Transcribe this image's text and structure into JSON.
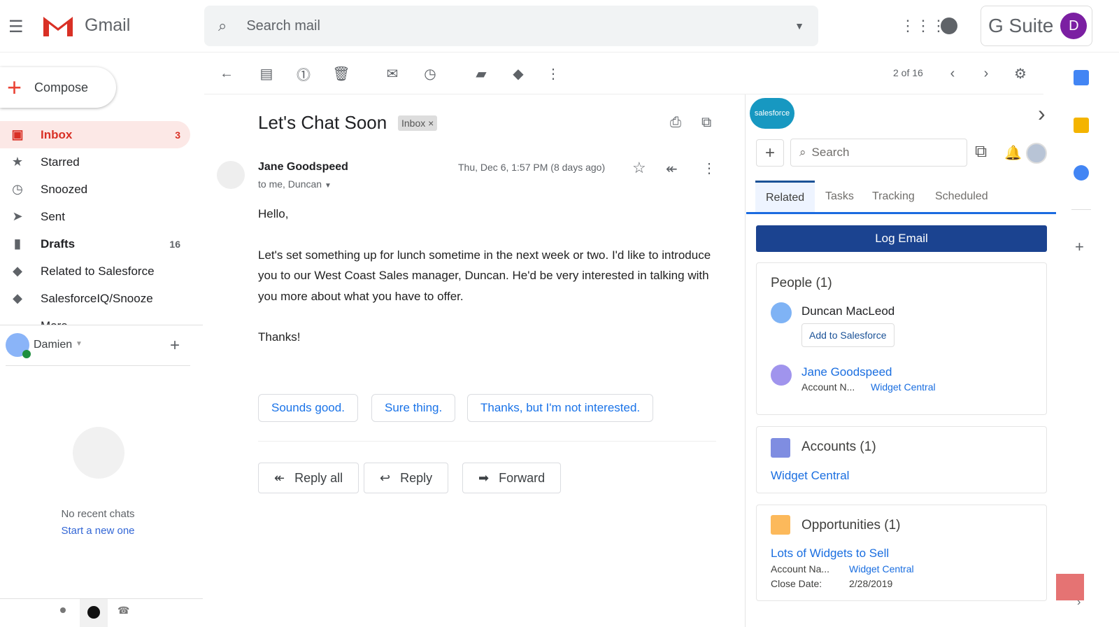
{
  "header": {
    "app_name": "Gmail",
    "search_placeholder": "Search mail",
    "gsuite": "G Suite",
    "avatar_letter": "D"
  },
  "compose": "Compose",
  "nav": [
    {
      "label": "Inbox",
      "count": "3",
      "icon": "inbox-icon"
    },
    {
      "label": "Starred",
      "count": "",
      "icon": "star-icon"
    },
    {
      "label": "Snoozed",
      "count": "",
      "icon": "clock-icon"
    },
    {
      "label": "Sent",
      "count": "",
      "icon": "send-icon"
    },
    {
      "label": "Drafts",
      "count": "16",
      "icon": "draft-icon"
    },
    {
      "label": "Related to Salesforce",
      "count": "",
      "icon": "label-icon"
    },
    {
      "label": "SalesforceIQ/Snooze",
      "count": "",
      "icon": "label-icon"
    },
    {
      "label": "More",
      "count": "",
      "icon": "chevron-down-icon"
    }
  ],
  "chat": {
    "user": "Damien",
    "empty": "No recent chats",
    "start": "Start a new one"
  },
  "toolbar": {
    "pager": "2 of 16"
  },
  "email": {
    "subject": "Let's Chat Soon",
    "label": "Inbox",
    "sender": "Jane Goodspeed",
    "to": "to me, Duncan",
    "date": "Thu, Dec 6, 1:57 PM (8 days ago)",
    "body": [
      "Hello,",
      "Let's set something up for lunch sometime in the next week or two. I'd like to introduce you to our West Coast Sales manager, Duncan. He'd be very interested in talking with you more about what you have to offer.",
      "Thanks!"
    ],
    "smart_replies": [
      "Sounds good.",
      "Sure thing.",
      "Thanks, but I'm not interested."
    ],
    "actions": [
      "Reply all",
      "Reply",
      "Forward"
    ]
  },
  "salesforce": {
    "logo": "salesforce",
    "search_placeholder": "Search",
    "tabs": [
      "Related",
      "Tasks",
      "Tracking",
      "Scheduled"
    ],
    "log_email": "Log Email",
    "people": {
      "title": "People (1)",
      "p1": "Duncan MacLeod",
      "add": "Add to Salesforce",
      "p2": "Jane Goodspeed",
      "p2_label": "Account N...",
      "p2_value": "Widget Central"
    },
    "accounts": {
      "title": "Accounts (1)",
      "item": "Widget Central"
    },
    "opportunities": {
      "title": "Opportunities (1)",
      "item": "Lots of Widgets to Sell",
      "acct_label": "Account Na...",
      "acct_value": "Widget Central",
      "close_label": "Close Date:",
      "close_value": "2/28/2019"
    }
  },
  "colors": {
    "brand_red": "#d93025",
    "sf_blue": "#1b5297",
    "link": "#1a73e8"
  }
}
